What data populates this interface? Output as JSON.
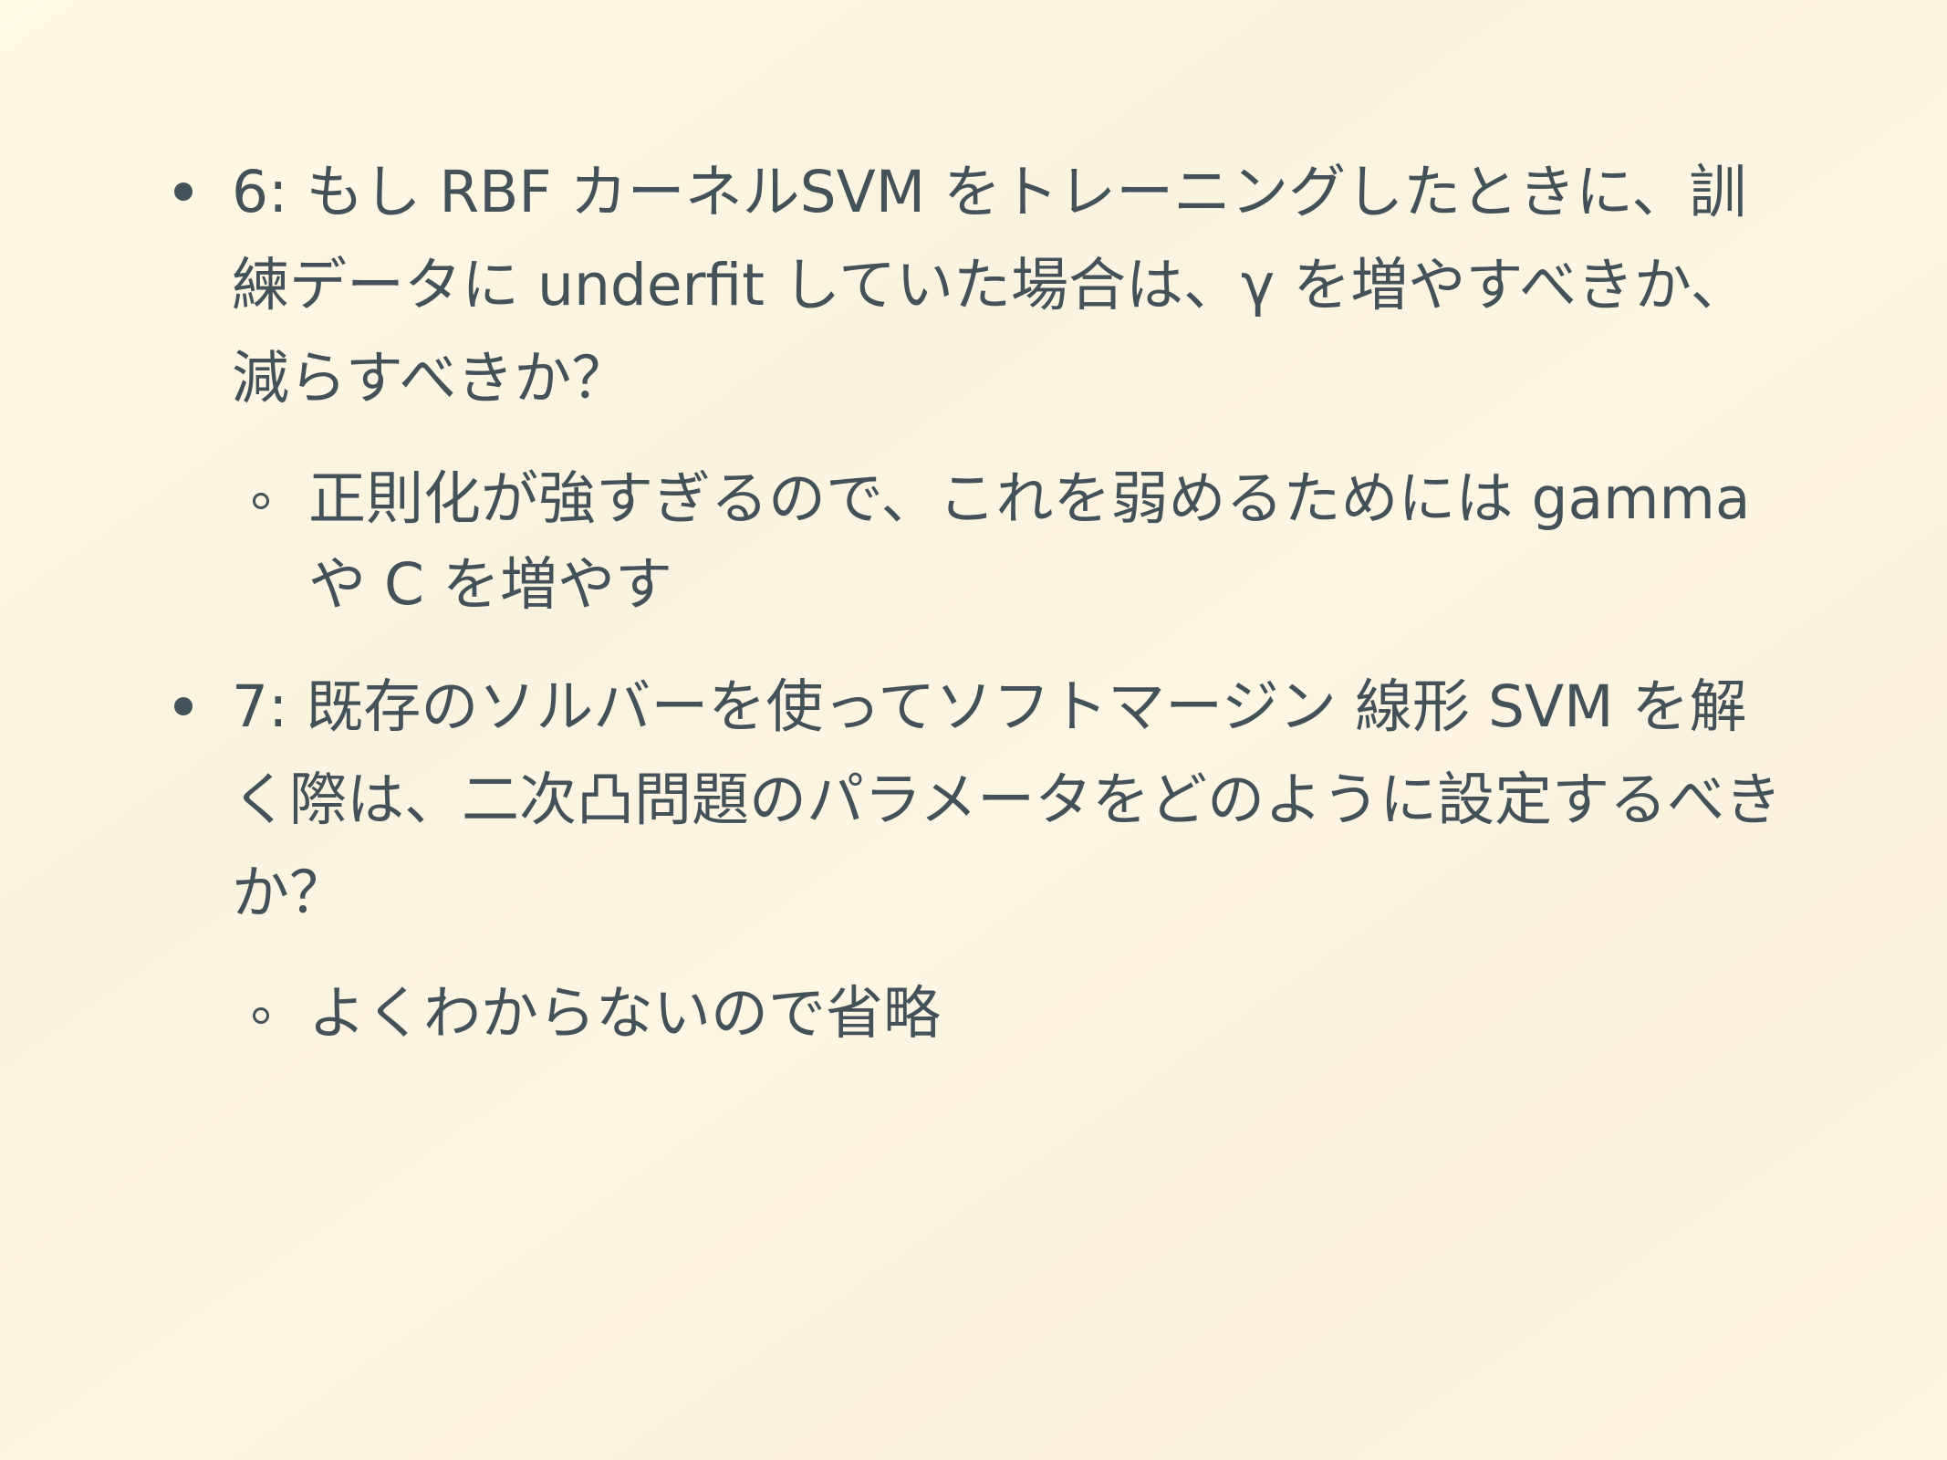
{
  "items": [
    {
      "text": "6: もし RBF カーネルSVM をトレーニングしたときに、訓練データに underfit していた場合は、γ を増やすべきか、減らすべきか？",
      "sub": "正則化が強すぎるので、これを弱めるためには gamma や C を増やす"
    },
    {
      "text": "7: 既存のソルバーを使ってソフトマージン 線形 SVM を解く際は、二次凸問題のパラメータをどのように設定するべきか？",
      "sub": "よくわからないので省略"
    }
  ]
}
